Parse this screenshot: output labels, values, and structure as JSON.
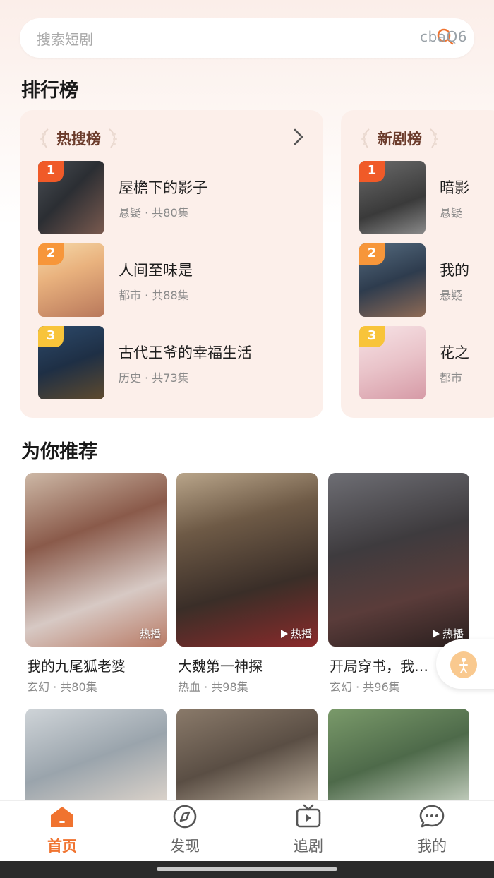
{
  "search": {
    "placeholder": "搜索短剧",
    "watermark": "cbaQ6"
  },
  "sections": {
    "rank_title": "排行榜",
    "recommend_title": "为你推荐"
  },
  "rankings": [
    {
      "title": "热搜榜",
      "items": [
        {
          "rank": "1",
          "title": "屋檐下的影子",
          "meta": "悬疑 · 共80集"
        },
        {
          "rank": "2",
          "title": "人间至味是",
          "meta": "都市 · 共88集"
        },
        {
          "rank": "3",
          "title": "古代王爷的幸福生活",
          "meta": "历史 · 共73集"
        }
      ]
    },
    {
      "title": "新剧榜",
      "items": [
        {
          "rank": "1",
          "title": "暗影",
          "meta": "悬疑"
        },
        {
          "rank": "2",
          "title": "我的",
          "meta": "悬疑"
        },
        {
          "rank": "3",
          "title": "花之",
          "meta": "都市"
        }
      ]
    }
  ],
  "recommend": [
    {
      "title": "我的九尾狐老婆",
      "meta": "玄幻 · 共80集",
      "hot_label": "热播"
    },
    {
      "title": "大魏第一神探",
      "meta": "热血 · 共98集",
      "hot_label": "热播"
    },
    {
      "title": "开局穿书，我…",
      "meta": "玄幻 · 共96集",
      "hot_label": "热播"
    }
  ],
  "nav": [
    {
      "label": "首页",
      "icon": "home-icon",
      "active": true
    },
    {
      "label": "发现",
      "icon": "discover-icon",
      "active": false
    },
    {
      "label": "追剧",
      "icon": "tv-icon",
      "active": false
    },
    {
      "label": "我的",
      "icon": "chat-icon",
      "active": false
    }
  ],
  "colors": {
    "accent": "#f0732f",
    "panel_bg": "#fcefea",
    "badge_1": "#f05a28",
    "badge_2": "#f7963a",
    "badge_3": "#f8c43a"
  }
}
